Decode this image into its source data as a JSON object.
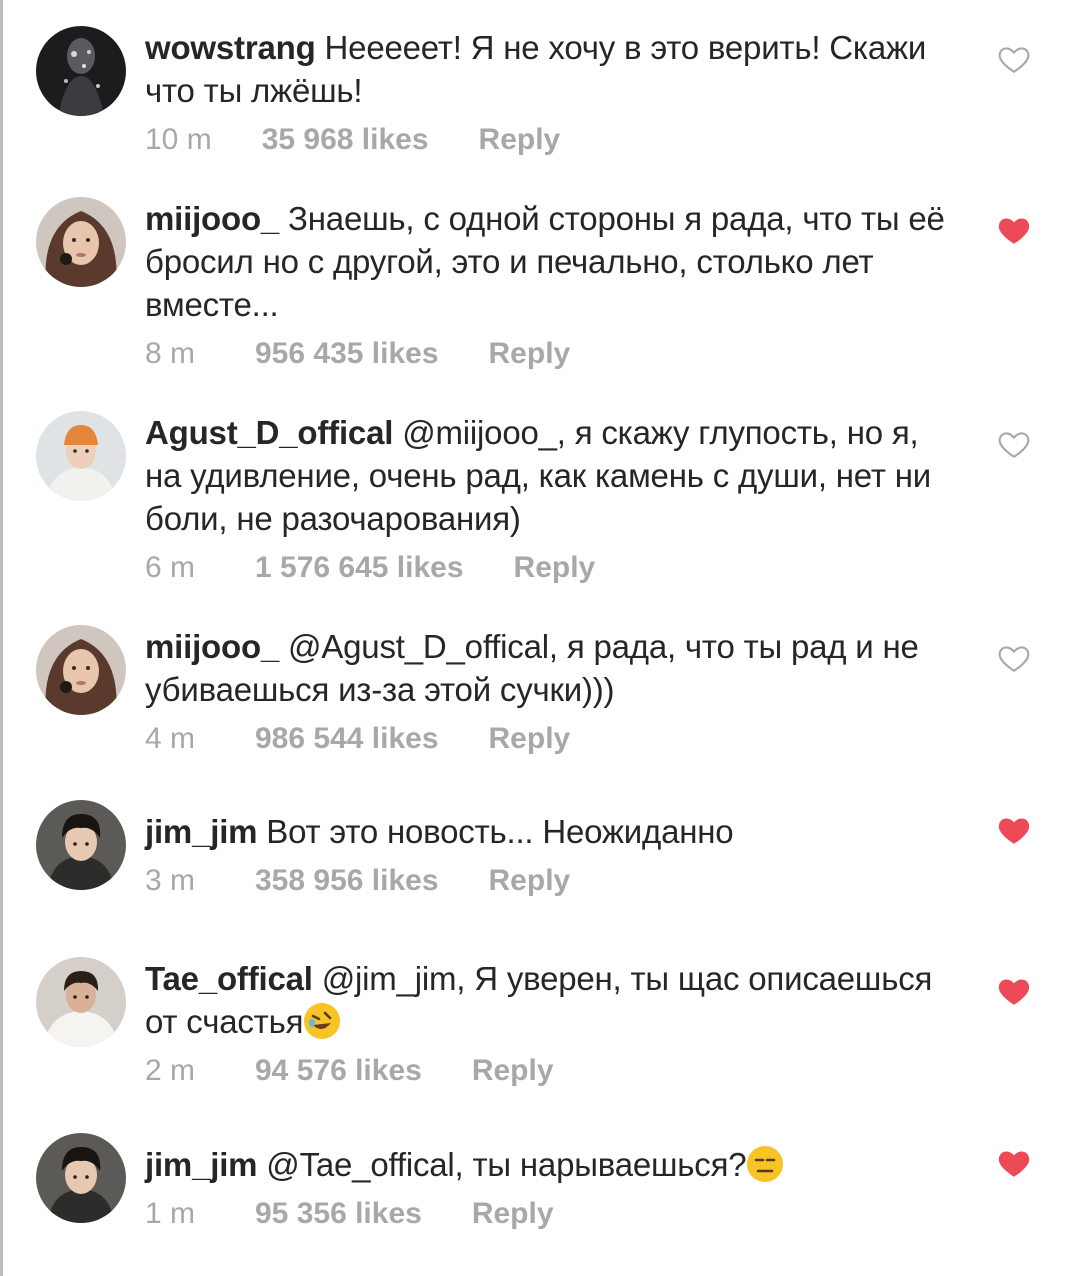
{
  "comments": [
    {
      "username": "wowstrang",
      "text": "Нееееет! Я не хочу в это верить! Скажи что ты лжёшь!",
      "time": "10 m",
      "likes": "35 968 likes",
      "reply": "Reply",
      "liked": false,
      "avatar": "dark-figure"
    },
    {
      "username": "miijooo_",
      "text": "Знаешь, с одной стороны я рада, что ты её бросил но с другой, это и печально, столько лет вместе...",
      "time": "8 m",
      "likes": "956 435 likes",
      "reply": "Reply",
      "liked": true,
      "avatar": "girl-brown-hair"
    },
    {
      "username": "Agust_D_offical",
      "text": "@miijooo_, я скажу глупость, но я, на удивление, очень рад, как камень с души, нет ни боли, не разочарования)",
      "time": "6 m",
      "likes": "1 576 645 likes",
      "reply": "Reply",
      "liked": false,
      "avatar": "man-orange-beanie"
    },
    {
      "username": "miijooo_",
      "text": "@Agust_D_offical, я рада, что ты рад и не убиваешься из-за этой сучки)))",
      "time": "4 m",
      "likes": "986 544 likes",
      "reply": "Reply",
      "liked": false,
      "avatar": "girl-brown-hair"
    },
    {
      "username": "jim_jim",
      "text": "Вот это новость... Неожиданно",
      "time": "3 m",
      "likes": "358 956 likes",
      "reply": "Reply",
      "liked": true,
      "avatar": "man-dark-hair"
    },
    {
      "username": "Tae_offical",
      "text": "@jim_jim, Я уверен, ты щас описаешься от счастья",
      "emoji": "rofl",
      "time": "2 m",
      "likes": "94 576 likes",
      "reply": "Reply",
      "liked": true,
      "avatar": "man-white-shirt"
    },
    {
      "username": "jim_jim",
      "text": "@Tae_offical, ты нарываешься?",
      "emoji": "expressionless",
      "time": "1 m",
      "likes": "95 356 likes",
      "reply": "Reply",
      "liked": true,
      "avatar": "man-dark-hair"
    }
  ],
  "colors": {
    "text": "#262626",
    "meta": "#a8a8a8",
    "heart_liked": "#ed4956",
    "heart_outline": "#a8a8a8",
    "emoji": "#f7c325"
  }
}
